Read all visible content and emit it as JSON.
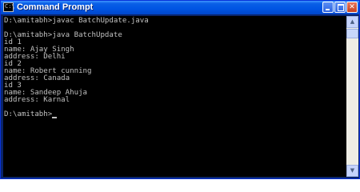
{
  "window": {
    "title": "Command Prompt",
    "icon": "cmd-app-icon",
    "icon_text": "C:\\"
  },
  "controls": {
    "minimize_icon": "minimize-icon",
    "maximize_icon": "maximize-icon",
    "close_icon": "close-icon",
    "close_glyph": "✕"
  },
  "console": {
    "lines": [
      "D:\\amitabh>javac BatchUpdate.java",
      "",
      "D:\\amitabh>java BatchUpdate",
      "id 1",
      "name: Ajay Singh",
      "address: Delhi",
      "id 2",
      "name: Robert cunning",
      "address: Canada",
      "id 3",
      "name: Sandeep Ahuja",
      "address: Karnal",
      "",
      "D:\\amitabh>"
    ]
  },
  "scrollbar": {
    "up_arrow": "▲",
    "down_arrow": "▼"
  },
  "colors": {
    "titlebar": "#0054e3",
    "console_bg": "#000000",
    "console_text": "#c0c0c0"
  }
}
